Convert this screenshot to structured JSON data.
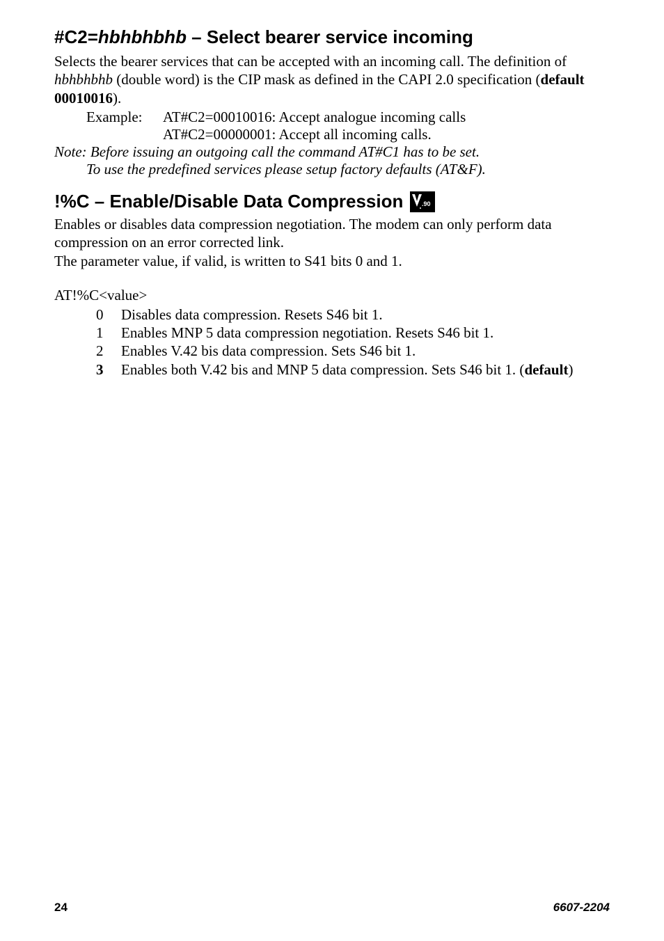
{
  "section1": {
    "heading_prefix": "#C2=",
    "heading_italic": "hbhbhbhb",
    "heading_suffix": " – Select bearer service incoming",
    "para1_a": "Selects the bearer services that can be accepted with an incoming call. The definition of ",
    "para1_italic": "hbhbhbhb",
    "para1_b": " (double word) is the CIP mask as defined in the CAPI 2.0 specification (",
    "para1_bold": "default 00010016",
    "para1_c": ").",
    "example_label": "Example:",
    "example_line1": "AT#C2=00010016: Accept analogue incoming calls",
    "example_line2": "AT#C2=00000001: Accept all incoming calls.",
    "note_line1": "Note: Before issuing an outgoing call the command AT#C1 has to be set.",
    "note_line2": "To use the predefined services please setup factory defaults (AT&F)."
  },
  "section2": {
    "heading": "!%C – Enable/Disable Data Compression",
    "v90_alt": "V.90",
    "para1": "Enables or disables data compression negotiation. The modem can only perform data compression on an error corrected link.",
    "para2": "The parameter value, if valid, is written to S41 bits 0 and 1.",
    "at_line": "AT!%C<value>",
    "items": [
      {
        "n": "0",
        "t": "Disables data compression. Resets S46 bit 1.",
        "bold_n": false,
        "suffix": ""
      },
      {
        "n": "1",
        "t": "Enables MNP 5 data compression negotiation. Resets S46 bit 1.",
        "bold_n": false,
        "suffix": ""
      },
      {
        "n": "2",
        "t": "Enables V.42 bis data compression. Sets S46 bit 1.",
        "bold_n": false,
        "suffix": ""
      },
      {
        "n": "3",
        "t": "Enables both V.42 bis and MNP 5 data compression. Sets S46 bit 1. (",
        "bold_n": true,
        "suffix_bold": "default",
        "suffix_close": ")"
      }
    ]
  },
  "footer": {
    "page": "24",
    "doc": "6607-2204"
  }
}
